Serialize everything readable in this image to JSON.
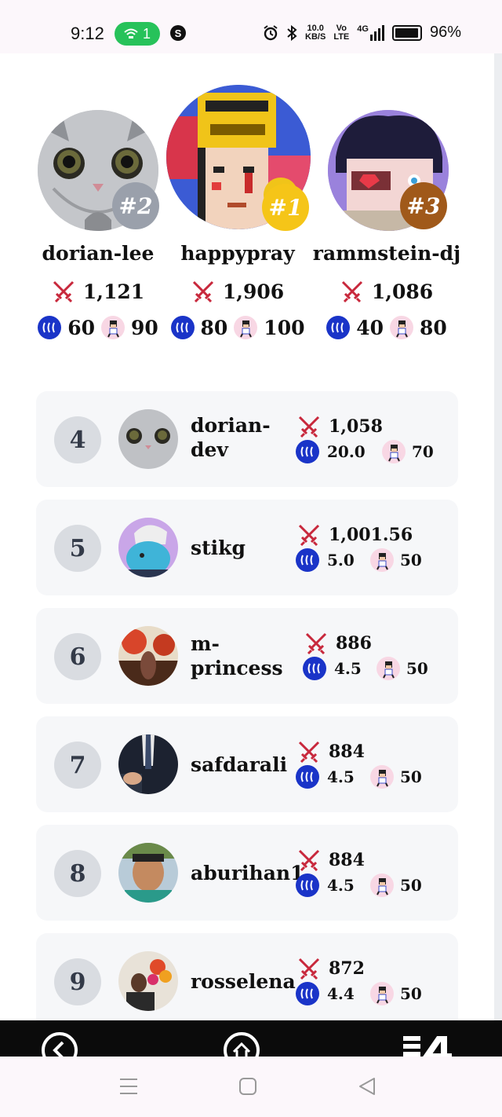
{
  "status_bar": {
    "time": "9:12",
    "hotspot_count": "1",
    "app_letter": "S",
    "net_speed_top": "10.0",
    "net_speed_bottom": "KB/S",
    "volte_top": "Vo",
    "volte_bottom": "LTE",
    "signal_label": "4G",
    "battery": "96%"
  },
  "podium": [
    {
      "rank_label": "#2",
      "name": "dorian-lee",
      "score": "1,121",
      "sp": "60",
      "pass": "90",
      "badge_color": "#9aa0ab"
    },
    {
      "rank_label": "#1",
      "name": "happypray",
      "score": "1,906",
      "sp": "80",
      "pass": "100",
      "badge_color": "#f5c518"
    },
    {
      "rank_label": "#3",
      "name": "rammstein-dj",
      "score": "1,086",
      "sp": "40",
      "pass": "80",
      "badge_color": "#a0591a"
    }
  ],
  "rows": [
    {
      "rank": "4",
      "name_line1": "dorian-",
      "name_line2": "dev",
      "score": "1,058",
      "sp": "20.0",
      "pass": "70"
    },
    {
      "rank": "5",
      "name_line1": "stikg",
      "name_line2": "",
      "score": "1,001.56",
      "sp": "5.0",
      "pass": "50"
    },
    {
      "rank": "6",
      "name_line1": "m-",
      "name_line2": "princess",
      "score": "886",
      "sp": "4.5",
      "pass": "50"
    },
    {
      "rank": "7",
      "name_line1": "safdarali",
      "name_line2": "",
      "score": "884",
      "sp": "4.5",
      "pass": "50"
    },
    {
      "rank": "8",
      "name_line1": "aburihan1",
      "name_line2": "",
      "score": "884",
      "sp": "4.5",
      "pass": "50"
    },
    {
      "rank": "9",
      "name_line1": "rosselena",
      "name_line2": "",
      "score": "872",
      "sp": "4.4",
      "pass": "50"
    }
  ],
  "icons": {
    "score": "swords-icon",
    "sp": "steem-icon",
    "pass": "battle-pass-icon"
  },
  "colors": {
    "steem_blue": "#1a34c8",
    "swords_red": "#c8283c",
    "card_bg": "#f6f7f9"
  }
}
